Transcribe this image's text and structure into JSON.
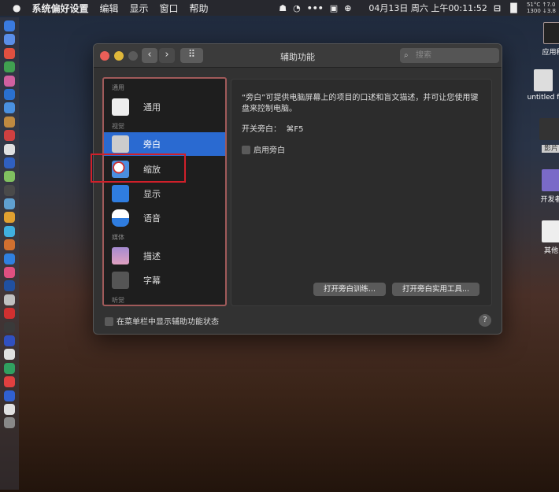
{
  "menubar": {
    "apple": "",
    "app": "系统偏好设置",
    "items": [
      "编辑",
      "显示",
      "窗口",
      "帮助"
    ],
    "datetime": "04月13日 周六 上午00:11:52",
    "temp1": "51°C ↑7.0",
    "temp2": "1300 ↓3.8"
  },
  "desktop": {
    "icons": [
      "应用程",
      "untitled f",
      "影片",
      "开发者",
      "其他"
    ]
  },
  "window": {
    "title": "辅助功能",
    "search_placeholder": "搜索",
    "grid": "⠿",
    "back": "‹",
    "forward": "›",
    "sidebar": {
      "sections": {
        "general": "通用",
        "vision": "视觉",
        "media": "媒体",
        "hearing": "听觉"
      },
      "items": [
        "通用",
        "旁白",
        "缩放",
        "显示",
        "语音",
        "描述",
        "字幕"
      ]
    },
    "pane": {
      "description": "“旁白”可提供电脑屏幕上的项目的口述和盲文描述，并可让您使用键盘来控制电脑。",
      "shortcut_label": "开关旁白：",
      "shortcut": "⌘F5",
      "enable": "启用旁白",
      "btn_training": "打开旁白训练...",
      "btn_utility": "打开旁白实用工具..."
    },
    "show_in_menubar": "在菜单栏中显示辅助功能状态",
    "help": "?"
  }
}
